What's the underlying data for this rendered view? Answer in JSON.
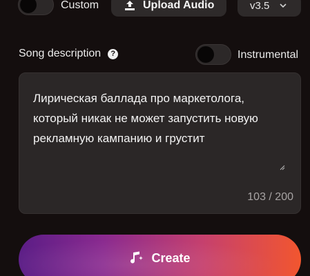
{
  "top_bar": {
    "custom_label": "Custom",
    "upload_label": "Upload Audio",
    "version": "v3.5"
  },
  "description": {
    "label": "Song description",
    "instrumental_label": "Instrumental",
    "text": "Лирическая баллада про маркетолога, который никак не может запустить новую рекламную кампанию и грустит",
    "char_count": "103 / 200"
  },
  "create": {
    "label": "Create"
  },
  "colors": {
    "background": "#140e0e",
    "gradient_start": "#5b1d86",
    "gradient_end": "#f2562f"
  }
}
